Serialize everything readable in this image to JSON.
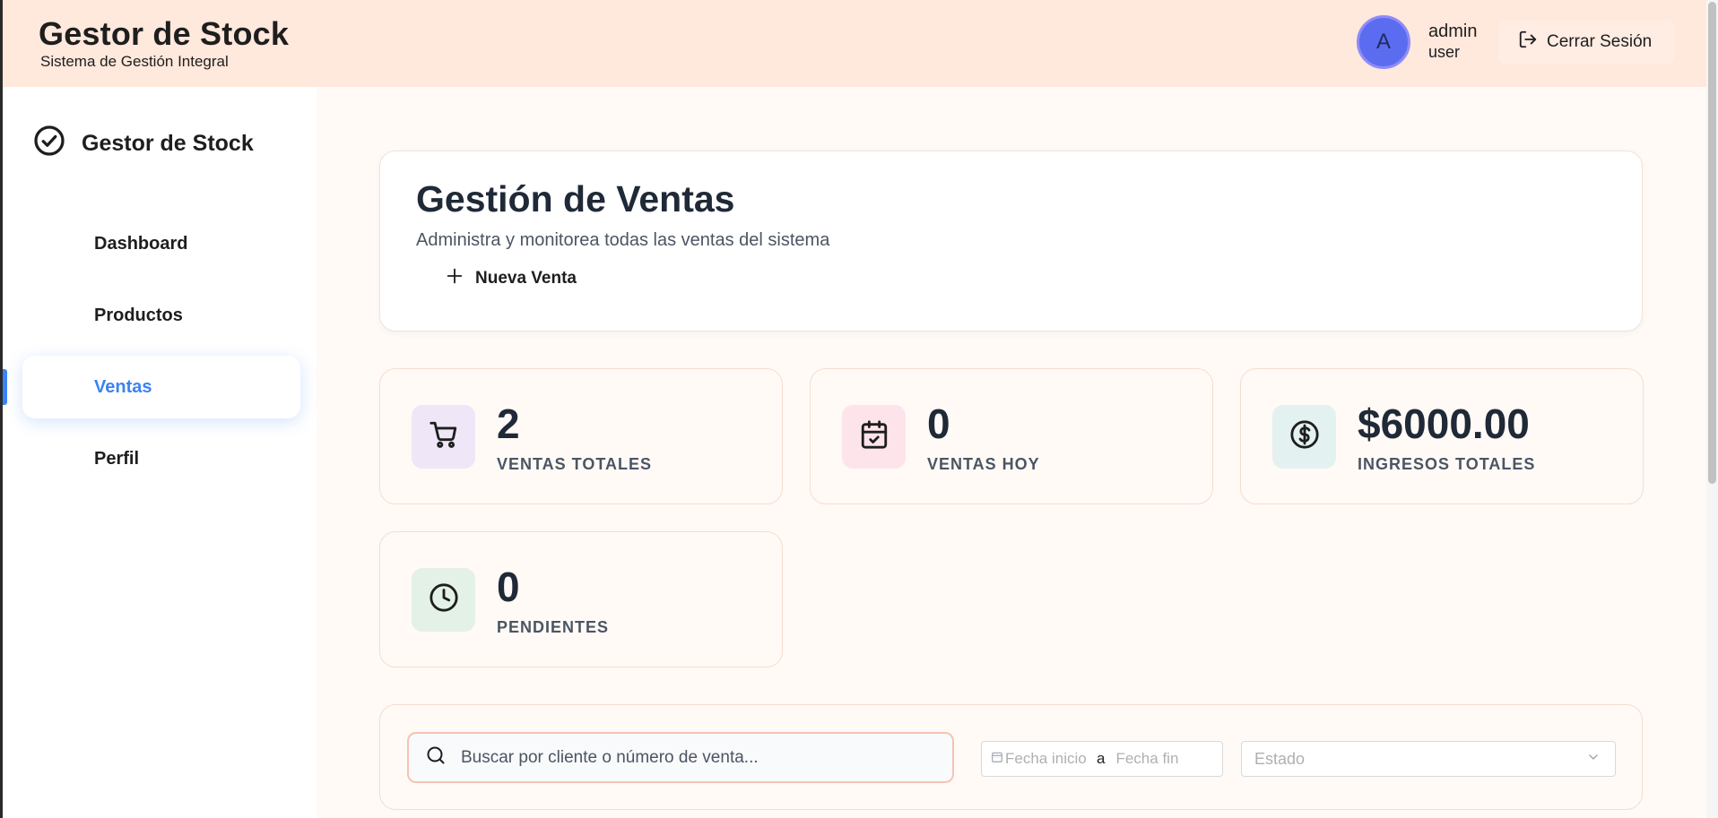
{
  "topbar": {
    "title": "Gestor de Stock",
    "subtitle": "Sistema de Gestión Integral",
    "avatar_initial": "A",
    "user_name": "admin",
    "user_role": "user",
    "logout_label": "Cerrar Sesión",
    "logout_icon": "logout-icon"
  },
  "sidebar": {
    "brand": "Gestor de Stock",
    "brand_icon": "check-circle-icon",
    "items": [
      {
        "label": "Dashboard",
        "active": false
      },
      {
        "label": "Productos",
        "active": false
      },
      {
        "label": "Ventas",
        "active": true
      },
      {
        "label": "Perfil",
        "active": false
      }
    ],
    "accent_color": "#3b82f6"
  },
  "header": {
    "title": "Gestión de Ventas",
    "subtitle": "Administra y monitorea todas las ventas del sistema",
    "new_sale_label": "Nueva Venta",
    "new_sale_icon": "plus-icon"
  },
  "stats": [
    {
      "value": "2",
      "label": "VENTAS TOTALES",
      "icon": "cart-icon",
      "icon_bg": "#efe6f7"
    },
    {
      "value": "0",
      "label": "VENTAS HOY",
      "icon": "calendar-check-icon",
      "icon_bg": "#fde4ea"
    },
    {
      "value": "$6000.00",
      "label": "INGRESOS TOTALES",
      "icon": "dollar-icon",
      "icon_bg": "#e4f1f1"
    },
    {
      "value": "0",
      "label": "PENDIENTES",
      "icon": "clock-icon",
      "icon_bg": "#e4f1e6"
    }
  ],
  "filters": {
    "search_placeholder": "Buscar por cliente o número de venta...",
    "date_start_placeholder": "Fecha inicio",
    "date_separator": "a",
    "date_end_placeholder": "Fecha fin",
    "status_placeholder": "Estado"
  }
}
